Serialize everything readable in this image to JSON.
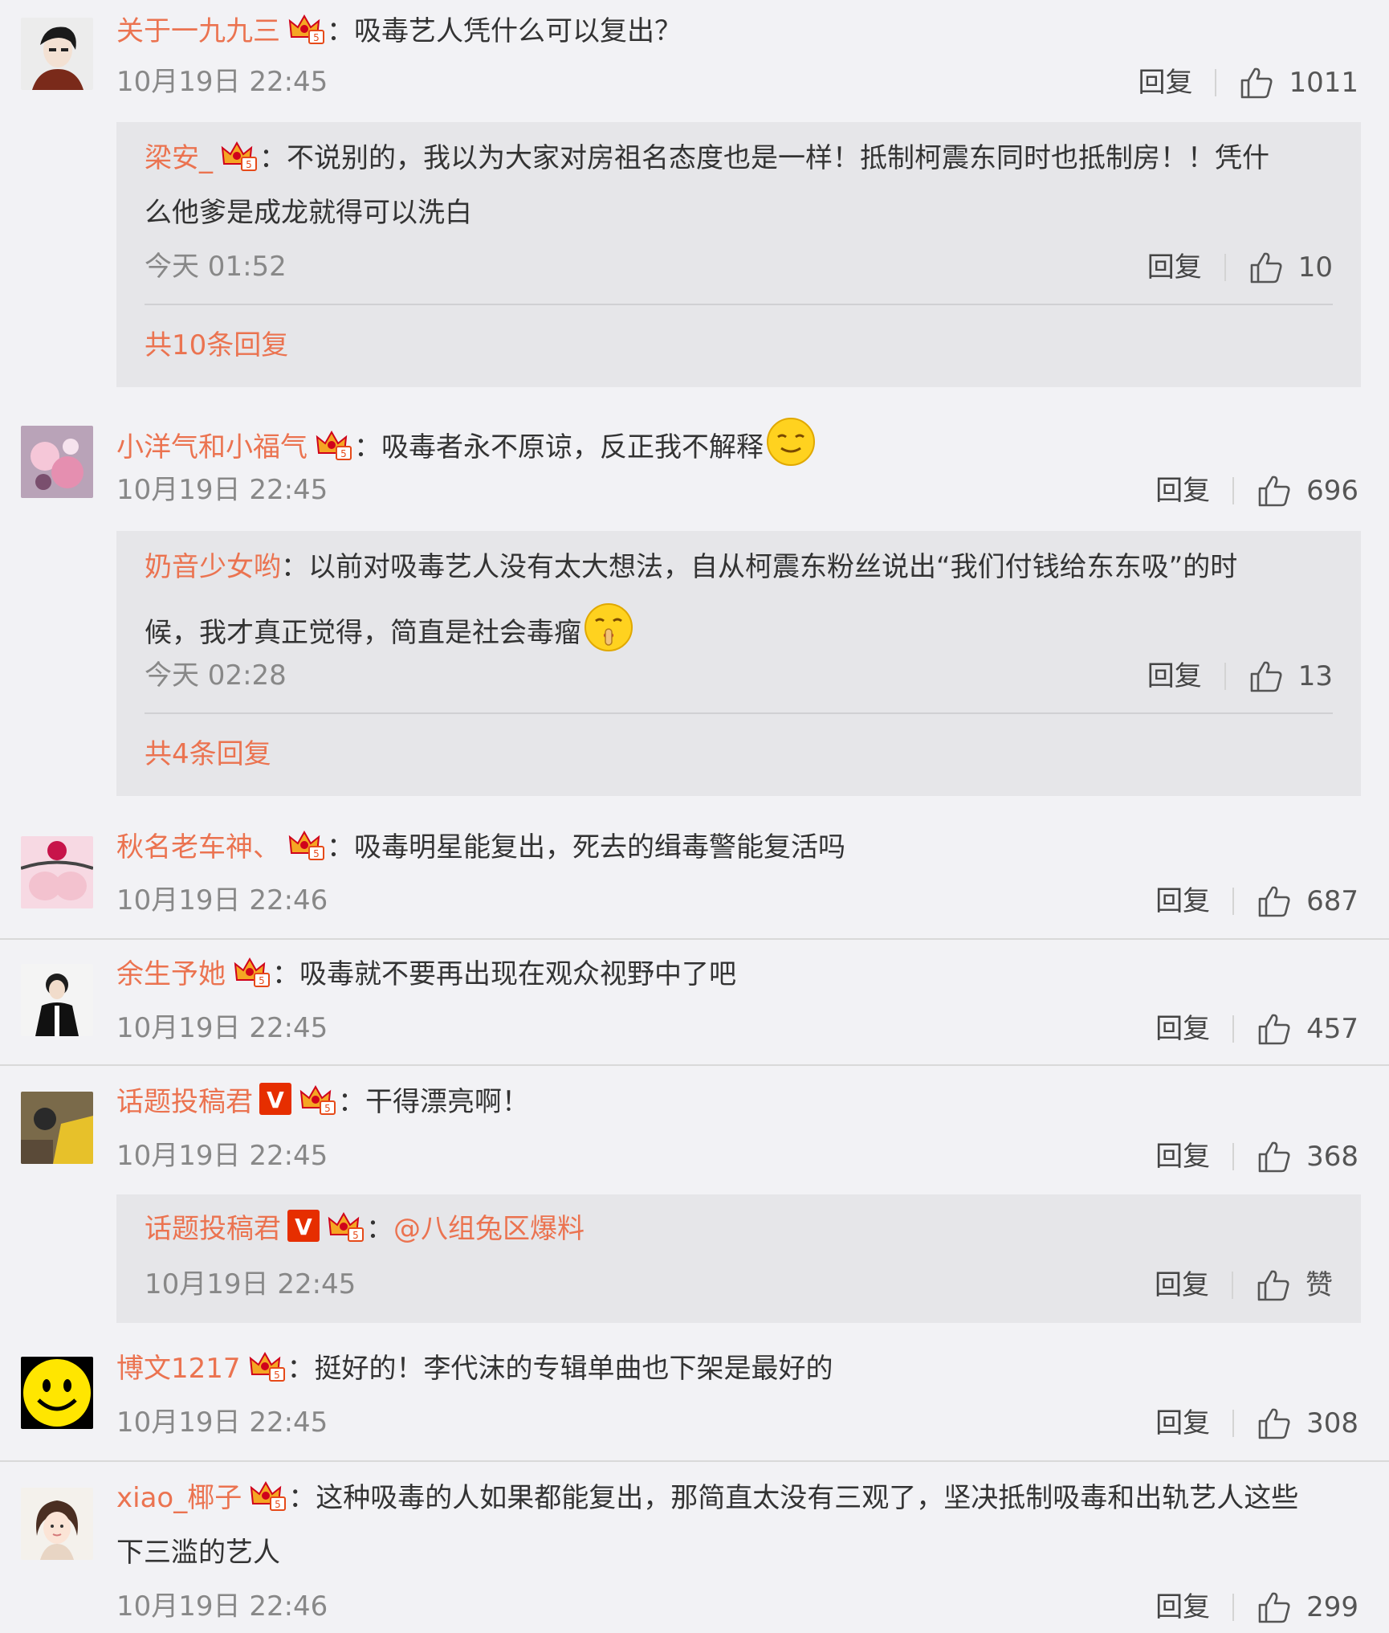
{
  "colors": {
    "username": "#eb7350",
    "text": "#333333",
    "meta": "#888888",
    "background": "#f2f2f5",
    "reply_box": "#e6e6e9",
    "v_badge": "#e62e00"
  },
  "labels": {
    "reply": "回复",
    "colon": "："
  },
  "comments": [
    {
      "user": "关于一九九三",
      "text": "吸毒艺人凭什么可以复出？",
      "time": "10月19日 22:45",
      "likes": "1011",
      "reply": {
        "user": "梁安_",
        "text_line1": "不说别的，我以为大家对房祖名态度也是一样！抵制柯震东同时也抵制房！！凭什",
        "text_line2": "么他爹是成龙就得可以洗白",
        "time": "今天 01:52",
        "likes": "10",
        "more": "共10条回复"
      }
    },
    {
      "user": "小洋气和小福气",
      "text": "吸毒者永不原谅，反正我不解释",
      "emoji": "smile-emoji",
      "time": "10月19日 22:45",
      "likes": "696",
      "reply": {
        "user": "奶音少女哟",
        "text_line1": "以前对吸毒艺人没有太大想法，自从柯震东粉丝说出“我们付钱给东东吸”的时",
        "text_line2": "候，我才真正觉得，简直是社会毒瘤",
        "emoji": "shush-emoji",
        "time": "今天 02:28",
        "likes": "13",
        "more": "共4条回复"
      }
    },
    {
      "user": "秋名老车神、",
      "text": "吸毒明星能复出，死去的缉毒警能复活吗",
      "time": "10月19日 22:46",
      "likes": "687"
    },
    {
      "user": "余生予她",
      "text": "吸毒就不要再出现在观众视野中了吧",
      "time": "10月19日 22:45",
      "likes": "457"
    },
    {
      "user": "话题投稿君",
      "verified": "V",
      "text": "干得漂亮啊！",
      "time": "10月19日 22:45",
      "likes": "368",
      "reply": {
        "user": "话题投稿君",
        "verified": "V",
        "mention": "@八组兔区爆料",
        "time": "10月19日 22:45",
        "likes": "赞"
      }
    },
    {
      "user": "博文1217",
      "text": "挺好的！李代沫的专辑单曲也下架是最好的",
      "time": "10月19日 22:45",
      "likes": "308"
    },
    {
      "user": "xiao_椰子",
      "text_line1": "这种吸毒的人如果都能复出，那简直太没有三观了，坚决抵制吸毒和出轨艺人这些",
      "text_line2": "下三滥的艺人",
      "time": "10月19日 22:46",
      "likes": "299"
    }
  ]
}
